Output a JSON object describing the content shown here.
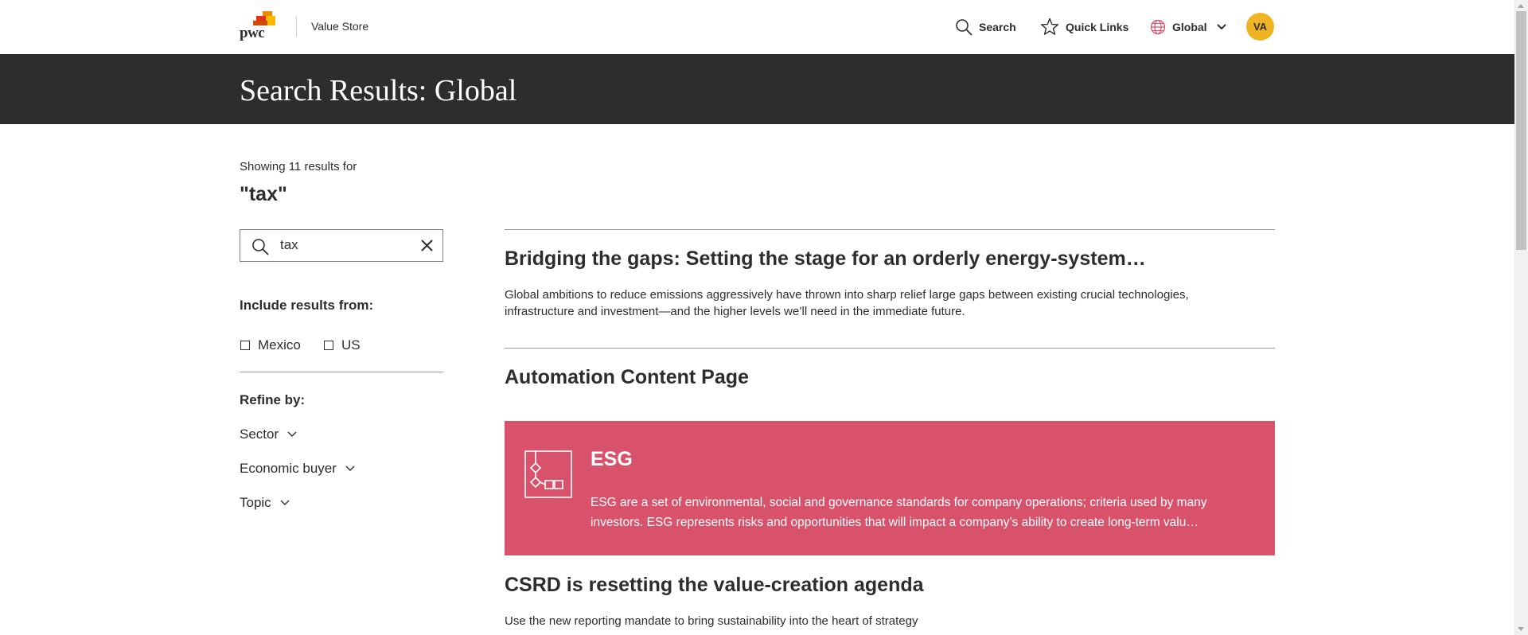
{
  "header": {
    "logo_text": "pwc",
    "store_label": "Value Store",
    "nav": {
      "search_label": "Search",
      "quick_links_label": "Quick Links",
      "region_label": "Global"
    },
    "avatar_initials": "VA"
  },
  "banner": {
    "title": "Search Results: Global"
  },
  "sidebar": {
    "showing_text": "Showing 11 results for",
    "query_text": "\"tax\"",
    "search_value": "tax",
    "include_heading": "Include results from:",
    "include_options": [
      {
        "label": "Mexico",
        "checked": false
      },
      {
        "label": "US",
        "checked": false
      }
    ],
    "refine_heading": "Refine by:",
    "facets": [
      {
        "label": "Sector"
      },
      {
        "label": "Economic buyer"
      },
      {
        "label": "Topic"
      }
    ]
  },
  "results": [
    {
      "title": "Bridging the gaps: Setting the stage for an orderly energy-system…",
      "description": "Global ambitions to reduce emissions aggressively have thrown into sharp relief large gaps between existing crucial technologies, infrastructure and investment—and the higher levels we’ll need in the immediate future."
    },
    {
      "title": "Automation Content Page",
      "description": ""
    },
    {
      "title": "ESG",
      "description": "ESG are a set of environmental, social and governance standards for company operations; criteria used by many investors. ESG represents risks and opportunities that will impact a company’s ability to create long-term valu…",
      "highlight_color": "#d9526b",
      "icon": "diagram-icon"
    },
    {
      "title": "CSRD is resetting the value-creation agenda",
      "description": "Use the new reporting mandate to bring sustainability into the heart of strategy"
    }
  ],
  "colors": {
    "banner": "#2d2d2d",
    "avatar": "#f0b323",
    "esg_card": "#d9526b",
    "text": "#2d2d2d"
  }
}
